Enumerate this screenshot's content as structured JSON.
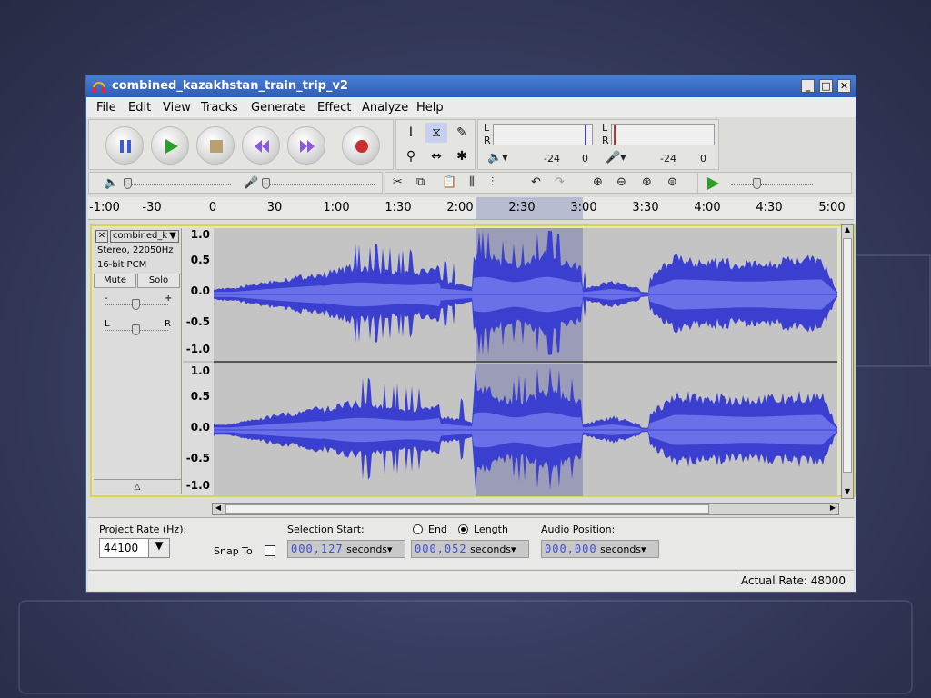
{
  "window": {
    "title": "combined_kazakhstan_train_trip_v2"
  },
  "menu": [
    "File",
    "Edit",
    "View",
    "Tracks",
    "Generate",
    "Effect",
    "Analyze",
    "Help"
  ],
  "meters": {
    "play_L": "L",
    "play_R": "R",
    "rec_L": "L",
    "rec_R": "R",
    "db1": "-24",
    "zero": "0",
    "db2": "-24",
    "zero2": "0"
  },
  "ruler_ticks": [
    "-1:00",
    "-30",
    "0",
    "30",
    "1:00",
    "1:30",
    "2:00",
    "2:30",
    "3:00",
    "3:30",
    "4:00",
    "4:30",
    "5:00"
  ],
  "track": {
    "name": "combined_k",
    "format": "Stereo, 22050Hz",
    "bits": "16-bit PCM",
    "mute": "Mute",
    "solo": "Solo",
    "gain_minus": "-",
    "gain_plus": "+",
    "pan_left": "L",
    "pan_right": "R",
    "scale": [
      "1.0",
      "0.5",
      "0.0",
      "-0.5",
      "-1.0"
    ]
  },
  "bottom": {
    "project_rate_label": "Project Rate (Hz):",
    "project_rate_value": "44100",
    "snap_label": "Snap To",
    "selection_start_label": "Selection Start:",
    "end_label": "End",
    "length_label": "Length",
    "audio_position_label": "Audio Position:",
    "selection_start": "000,127",
    "length": "000,052",
    "audio_position": "000,000",
    "unit": "seconds"
  },
  "status": {
    "actual_rate": "Actual Rate: 48000"
  },
  "colors": {
    "waveform": "#3a3fd0",
    "waveform_rms": "#6a70e8",
    "selection": "#9a9cb8",
    "titlebar": "#2d5db6"
  }
}
